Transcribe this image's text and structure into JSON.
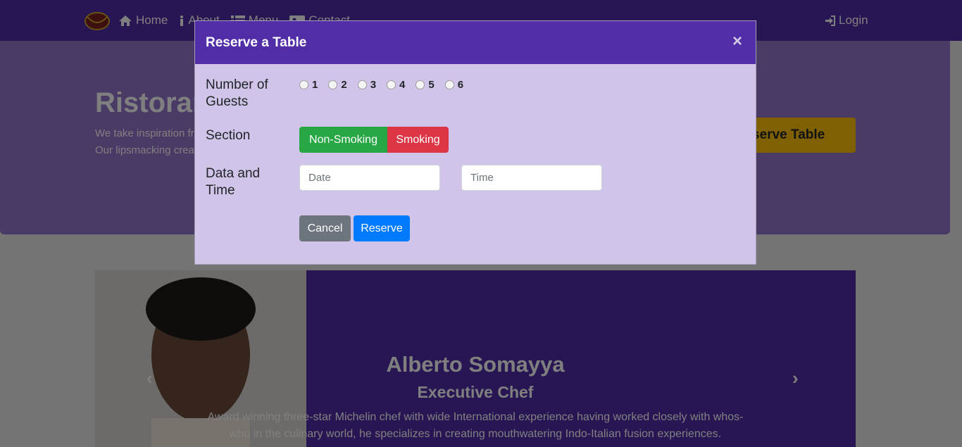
{
  "navbar": {
    "logo_icon": "restaurant-logo",
    "items": [
      {
        "label": "Home",
        "icon": "home-icon"
      },
      {
        "label": "About",
        "icon": "info-icon"
      },
      {
        "label": "Menu",
        "icon": "list-icon"
      },
      {
        "label": "Contact",
        "icon": "address-card-icon"
      }
    ],
    "login_label": "Login",
    "login_icon": "sign-in-icon",
    "background": "#512da8"
  },
  "jumbotron": {
    "title": "Ristorante Con Fusion",
    "text": "We take inspiration from the World's best cuisines, and create a unique fusion experience. Our lipsmacking creations will tickle your culinary senses!",
    "reserve_button": "Reserve Table",
    "background": "#9575cd"
  },
  "carousel": {
    "name": "Alberto Somayya",
    "role": "Executive Chef",
    "description": "Award winning three-star Michelin chef with wide International experience having worked closely with whos-who in the culinary world, he specializes in creating mouthwatering Indo-Italian fusion experiences.",
    "prev_icon": "chevron-left-icon",
    "next_icon": "chevron-right-icon"
  },
  "modal": {
    "title": "Reserve a Table",
    "close": "×",
    "guests_label": "Number of Guests",
    "guest_options": [
      "1",
      "2",
      "3",
      "4",
      "5",
      "6"
    ],
    "section_label": "Section",
    "section_options": [
      "Non-Smoking",
      "Smoking"
    ],
    "datetime_label": "Data and Time",
    "date_placeholder": "Date",
    "time_placeholder": "Time",
    "cancel_label": "Cancel",
    "reserve_label": "Reserve",
    "colors": {
      "header": "#512da8",
      "body": "#d1c4e9",
      "green": "#28a745",
      "red": "#dc3545",
      "blue": "#007bff",
      "gray": "#6c757d"
    }
  }
}
